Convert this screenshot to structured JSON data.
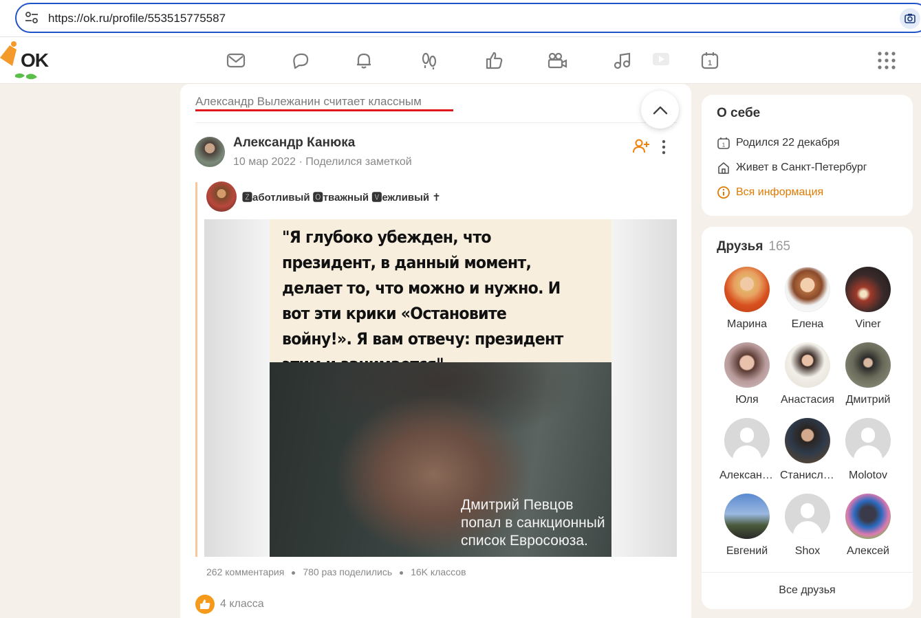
{
  "browser": {
    "url": "https://ok.ru/profile/553515775587"
  },
  "header": {
    "logo_text": "OK",
    "nav": [
      {
        "name": "messages-icon"
      },
      {
        "name": "discussions-icon"
      },
      {
        "name": "notifications-icon"
      },
      {
        "name": "guests-icon"
      },
      {
        "name": "likes-icon"
      },
      {
        "name": "video-icon"
      },
      {
        "name": "music-icon"
      },
      {
        "name": "games-icon"
      },
      {
        "name": "calendar-icon"
      }
    ]
  },
  "feed": {
    "liked_by": "Александр Вылежанин считает классным",
    "post": {
      "author": "Александр Канюка",
      "date": "10 мар 2022",
      "action": "Поделился заметкой",
      "meta": "10 мар 2022 · Поделился заметкой",
      "sub_author": "🆉аботливый 🅾тважный 🆅ежливый ✝",
      "quote": "\"Я глубоко убежден, что президент, в данный момент, делает то, что можно и нужно. И вот эти крики «Остановите войну!». Я вам отвечу: президент этим и занимается\"",
      "caption_line1": "Дмитрий Певцов",
      "caption_line2": "попал в санкционный",
      "caption_line3": "список Евросоюза.",
      "comments": "262 комментария",
      "shares": "780 раз поделились",
      "classes": "16K классов",
      "likes": "4 класса"
    }
  },
  "about": {
    "title": "О себе",
    "born": "Родился 22 декабря",
    "lives": "Живет в Санкт-Петербург",
    "all_info": "Вся информация"
  },
  "friends": {
    "title": "Друзья",
    "count": "165",
    "items": [
      {
        "name": "Марина"
      },
      {
        "name": "Елена"
      },
      {
        "name": "Viner"
      },
      {
        "name": "Юля"
      },
      {
        "name": "Анастасия"
      },
      {
        "name": "Дмитрий"
      },
      {
        "name": "Александр"
      },
      {
        "name": "Станислав"
      },
      {
        "name": "Molotov"
      },
      {
        "name": "Евгений"
      },
      {
        "name": "Shox"
      },
      {
        "name": "Алексей"
      }
    ],
    "all_label": "Все друзья"
  }
}
